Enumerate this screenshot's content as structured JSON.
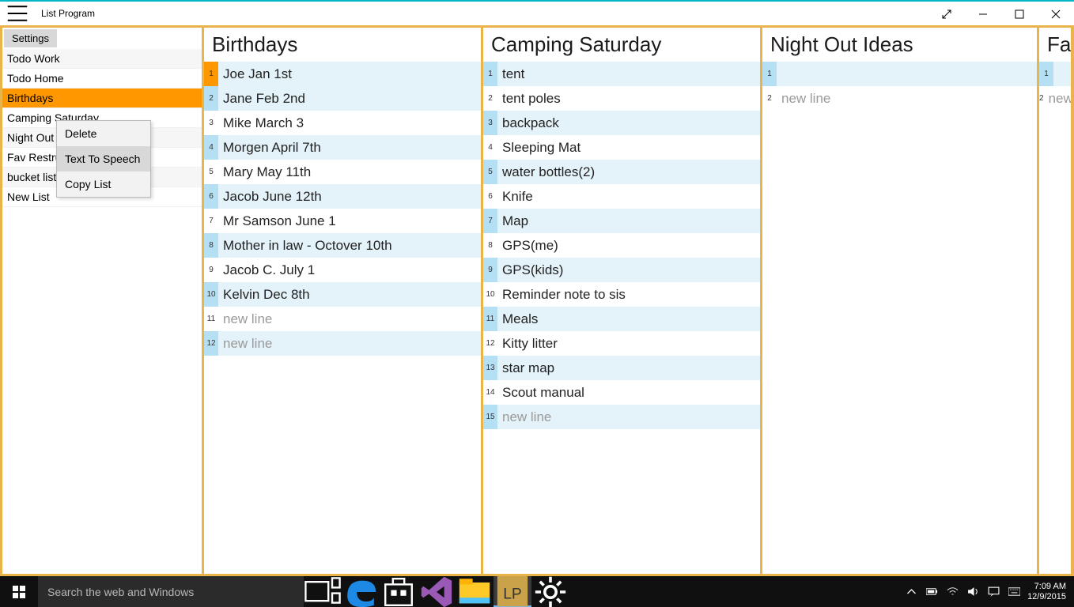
{
  "titlebar": {
    "title": "List Program"
  },
  "sidebar": {
    "settings_label": "Settings",
    "items": [
      {
        "label": "Todo Work"
      },
      {
        "label": "Todo Home"
      },
      {
        "label": "Birthdays"
      },
      {
        "label": "Camping Saturday"
      },
      {
        "label": "Night Out Ideas"
      },
      {
        "label": "Fav Restrurants"
      },
      {
        "label": "bucket list"
      }
    ],
    "new_list_label": "New List"
  },
  "context_menu": {
    "items": [
      {
        "label": "Delete"
      },
      {
        "label": "Text To Speech"
      },
      {
        "label": "Copy List"
      }
    ]
  },
  "columns": [
    {
      "title": "Birthdays",
      "items": [
        "Joe Jan 1st",
        "Jane Feb 2nd",
        "Mike March 3",
        "Morgen April 7th",
        "Mary May 11th",
        "Jacob June 12th",
        "Mr Samson June 1",
        "Mother in law - Octover 10th",
        "Jacob C. July 1",
        "Kelvin Dec 8th"
      ],
      "placeholders": [
        "new line",
        "new line"
      ]
    },
    {
      "title": "Camping Saturday",
      "items": [
        "tent",
        "tent poles",
        "backpack",
        "Sleeping Mat",
        "water bottles(2)",
        "Knife",
        "Map",
        "GPS(me)",
        "GPS(kids)",
        "Reminder note to sis",
        "Meals",
        "Kitty litter",
        "star map",
        "Scout manual"
      ],
      "placeholders": [
        "new line"
      ]
    },
    {
      "title": "Night Out Ideas",
      "items": [
        ""
      ],
      "placeholders": [
        "new line"
      ]
    },
    {
      "title": "Fav Restrurants",
      "items": [
        ""
      ],
      "placeholders": [
        "new line"
      ]
    }
  ],
  "taskbar": {
    "search_placeholder": "Search the web and Windows",
    "clock_time": "7:09 AM",
    "clock_date": "12/9/2015"
  }
}
